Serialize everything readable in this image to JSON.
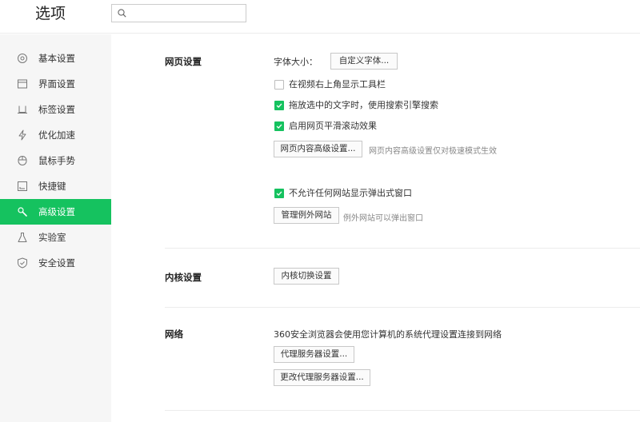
{
  "header": {
    "title": "选项",
    "search": {
      "placeholder": "",
      "value": ""
    }
  },
  "sidebar": {
    "items": [
      {
        "label": "基本设置",
        "icon": "gear-icon",
        "active": false
      },
      {
        "label": "界面设置",
        "icon": "window-icon",
        "active": false
      },
      {
        "label": "标签设置",
        "icon": "tab-icon",
        "active": false
      },
      {
        "label": "优化加速",
        "icon": "lightning-icon",
        "active": false
      },
      {
        "label": "鼠标手势",
        "icon": "mouse-icon",
        "active": false
      },
      {
        "label": "快捷键",
        "icon": "keyboard-icon",
        "active": false
      },
      {
        "label": "高级设置",
        "icon": "wrench-icon",
        "active": true
      },
      {
        "label": "实验室",
        "icon": "flask-icon",
        "active": false
      },
      {
        "label": "安全设置",
        "icon": "shield-icon",
        "active": false
      }
    ]
  },
  "webpage": {
    "title": "网页设置",
    "font_size_label": "字体大小：",
    "custom_font_button": "自定义字体...",
    "checkbox_toolbar": {
      "label": "在视频右上角显示工具栏",
      "checked": false
    },
    "checkbox_drag_search": {
      "label": "拖放选中的文字时，使用搜索引擎搜索",
      "checked": true
    },
    "checkbox_smooth_scroll": {
      "label": "启用网页平滑滚动效果",
      "checked": true
    },
    "advanced_content_button": "网页内容高级设置...",
    "advanced_content_hint": "网页内容高级设置仅对极速模式生效",
    "checkbox_popup": {
      "label": "不允许任何网站显示弹出式窗口",
      "checked": true
    },
    "manage_exceptions_button": "管理例外网站",
    "manage_exceptions_hint": "例外网站可以弹出窗口"
  },
  "kernel": {
    "title": "内核设置",
    "switch_button": "内核切换设置"
  },
  "network": {
    "title": "网络",
    "description": "360安全浏览器会使用您计算机的系统代理设置连接到网络",
    "proxy_button": "代理服务器设置...",
    "change_proxy_button": "更改代理服务器设置..."
  },
  "colors": {
    "accent": "#15c25f",
    "sidebar_bg": "#f6f6f6",
    "divider": "#ececec"
  }
}
